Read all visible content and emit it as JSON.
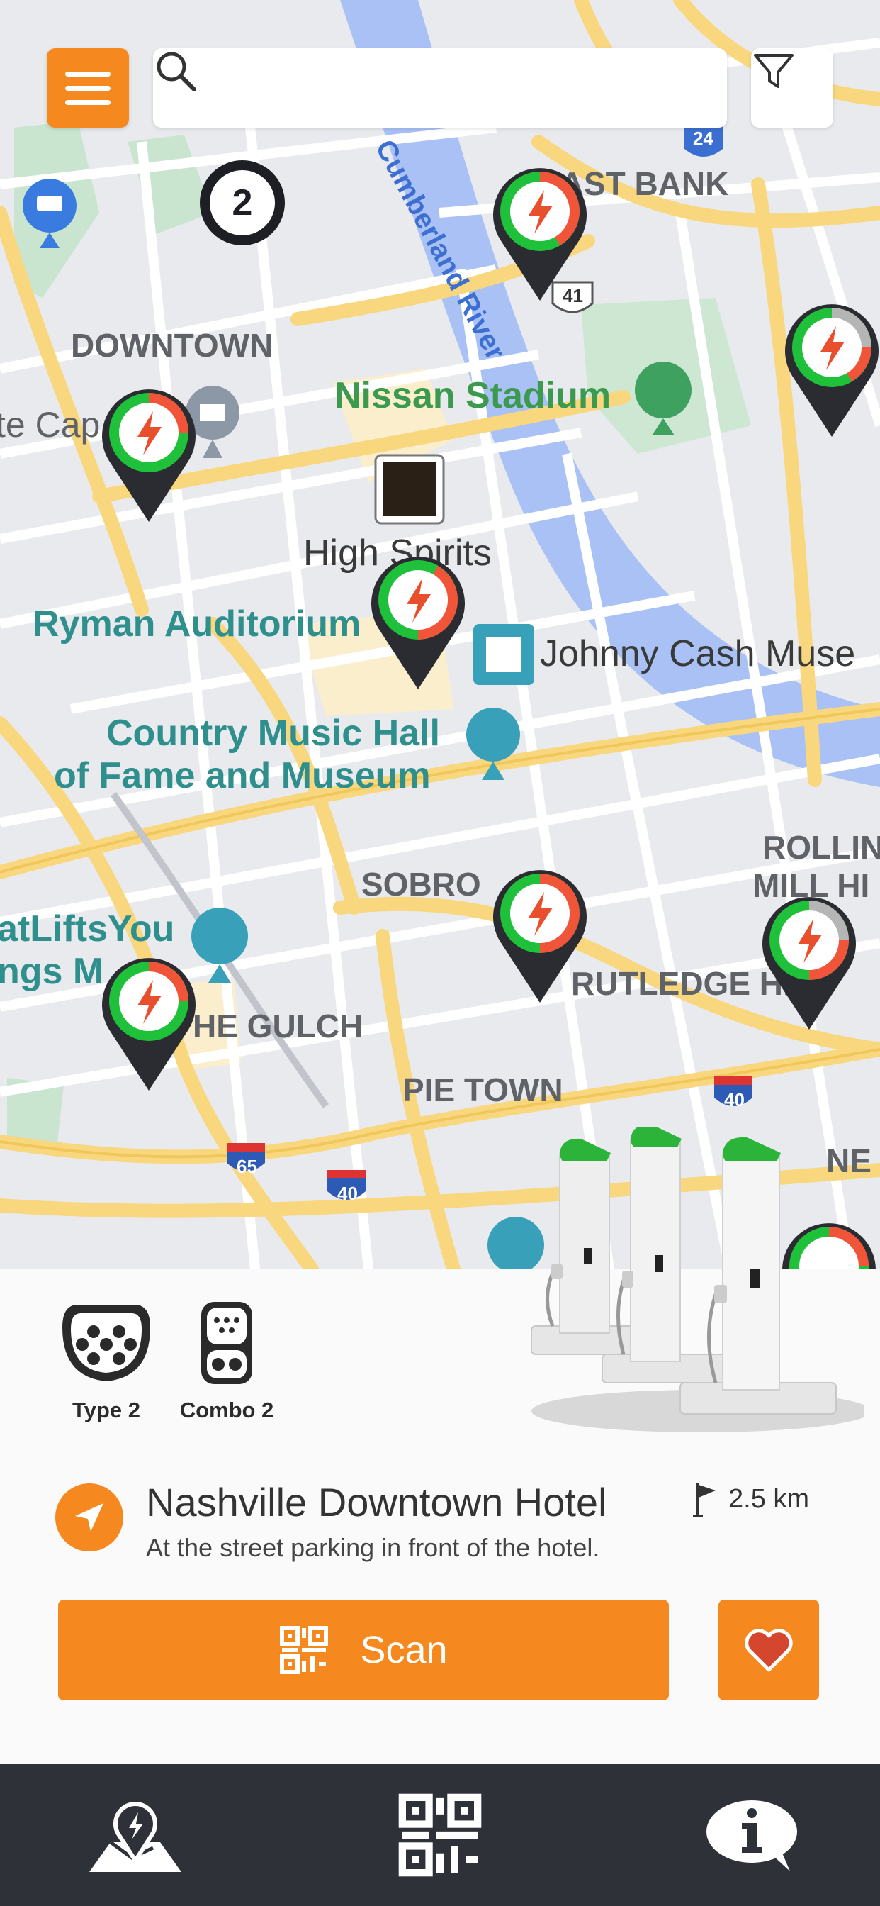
{
  "app": {
    "accent_color": "#F5891F",
    "nav_bg_color": "#2E3138"
  },
  "top_bar": {
    "menu_icon": "hamburger-menu-icon",
    "search": {
      "value": "",
      "placeholder": "",
      "icon": "search-icon"
    },
    "filter_icon": "filter-funnel-icon"
  },
  "map": {
    "labels": {
      "east_bank": "EAST BANK",
      "route_41": "41",
      "route_24": "24",
      "cumberland_river": "Cumberland River",
      "downtown": "DOWNTOWN",
      "nissan_stadium": "Nissan Stadium",
      "capitol_partial": "te Cap",
      "high_spirits": "High Spirits",
      "ryman_auditorium": "Ryman Auditorium",
      "johnny_cash": "Johnny Cash Muse",
      "country_music_hall_1": "Country Music Hall",
      "country_music_hall_2": "of Fame and Museum",
      "rolling_mill_1": "ROLLIN",
      "rolling_mill_2": "MILL HI",
      "sobro": "SOBRO",
      "rutledge_hill": "RUTLEDGE HILL",
      "lifts_you_1": "atLiftsYou",
      "lifts_you_2": "ngs M",
      "the_gulch": "HE GULCH",
      "pie_town": "PIE TOWN",
      "route_40_a": "40",
      "route_40_b": "40",
      "route_65": "65",
      "ne_partial": "NE"
    },
    "cluster_count": "2",
    "charger_pin_icon": "ev-charging-bolt-icon",
    "status_colors": {
      "available": "#1FC13A",
      "occupied": "#F0553A",
      "offline": "#B5B5B5",
      "pin": "#2A2C31",
      "bolt": "#E8502D"
    }
  },
  "station": {
    "connectors": [
      {
        "label": "Type 2",
        "icon": "type2-connector-icon"
      },
      {
        "label": "Combo 2",
        "icon": "combo2-connector-icon"
      }
    ],
    "name": "Nashville Downtown Hotel",
    "description": "At the street parking in front of the hotel.",
    "distance": "2.5 km",
    "scan_label": "Scan",
    "favorite_icon": "heart-icon"
  },
  "bottom_nav": [
    {
      "icon": "map-charging-pin-icon"
    },
    {
      "icon": "qr-code-icon"
    },
    {
      "icon": "info-bubble-icon"
    }
  ]
}
